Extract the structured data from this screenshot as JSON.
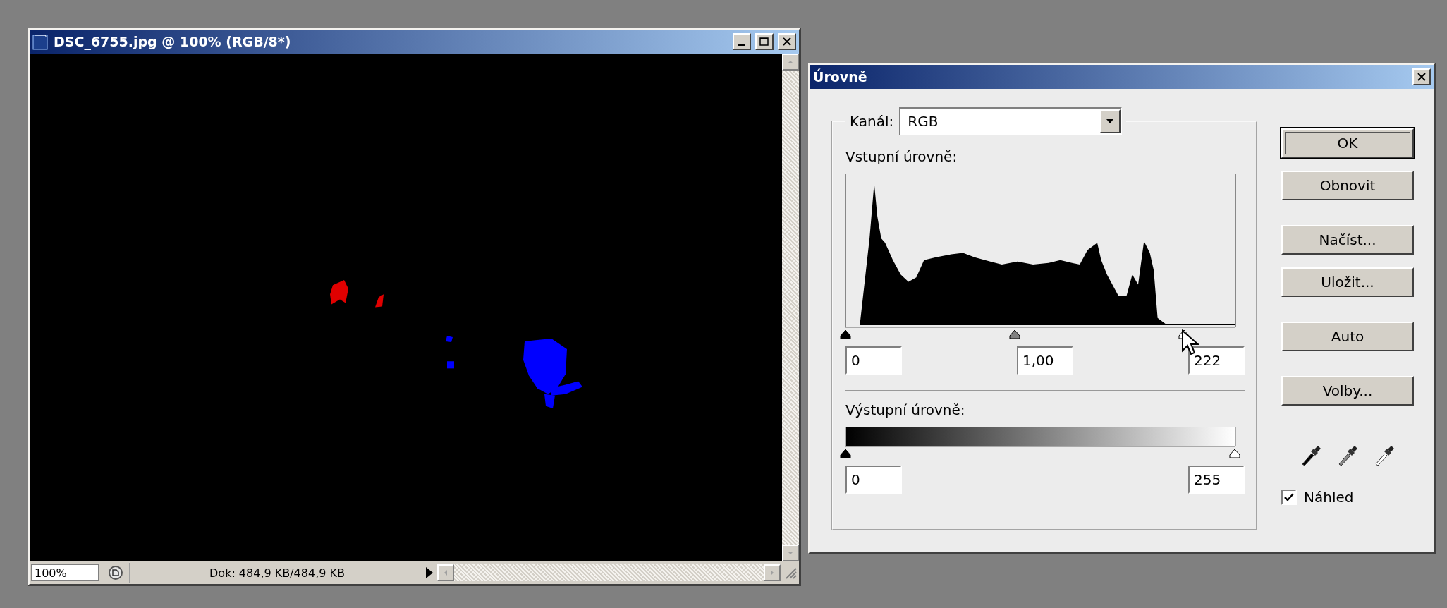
{
  "image_window": {
    "title": "DSC_6755.jpg @ 100% (RGB/8*)",
    "status_bar": {
      "zoom": "100%",
      "doc_info": "Dok: 484,9 KB/484,9 KB"
    }
  },
  "levels_dialog": {
    "title": "Úrovně",
    "channel": {
      "label": "Kanál:",
      "value": "RGB"
    },
    "input_levels": {
      "label": "Vstupní úrovně:",
      "sliders": [
        {
          "kind": "black",
          "level": 0
        },
        {
          "kind": "gray",
          "level": 0.435
        },
        {
          "kind": "white",
          "level": 0.87
        }
      ],
      "fields": [
        "0",
        "1,00",
        "222"
      ]
    },
    "output_levels": {
      "label": "Výstupní úrovně:",
      "sliders": [
        {
          "kind": "black",
          "level": 0
        },
        {
          "kind": "white",
          "level": 1
        }
      ],
      "fields": [
        "0",
        "255"
      ]
    },
    "buttons": [
      {
        "label": "OK",
        "default": true
      },
      {
        "label": "Obnovit",
        "default": false
      },
      {
        "label": "Načíst...",
        "default": false
      },
      {
        "label": "Uložit...",
        "default": false
      },
      {
        "label": "Auto",
        "default": false
      },
      {
        "label": "Volby...",
        "default": false
      }
    ],
    "preview": {
      "label": "Náhled",
      "checked": true
    }
  }
}
